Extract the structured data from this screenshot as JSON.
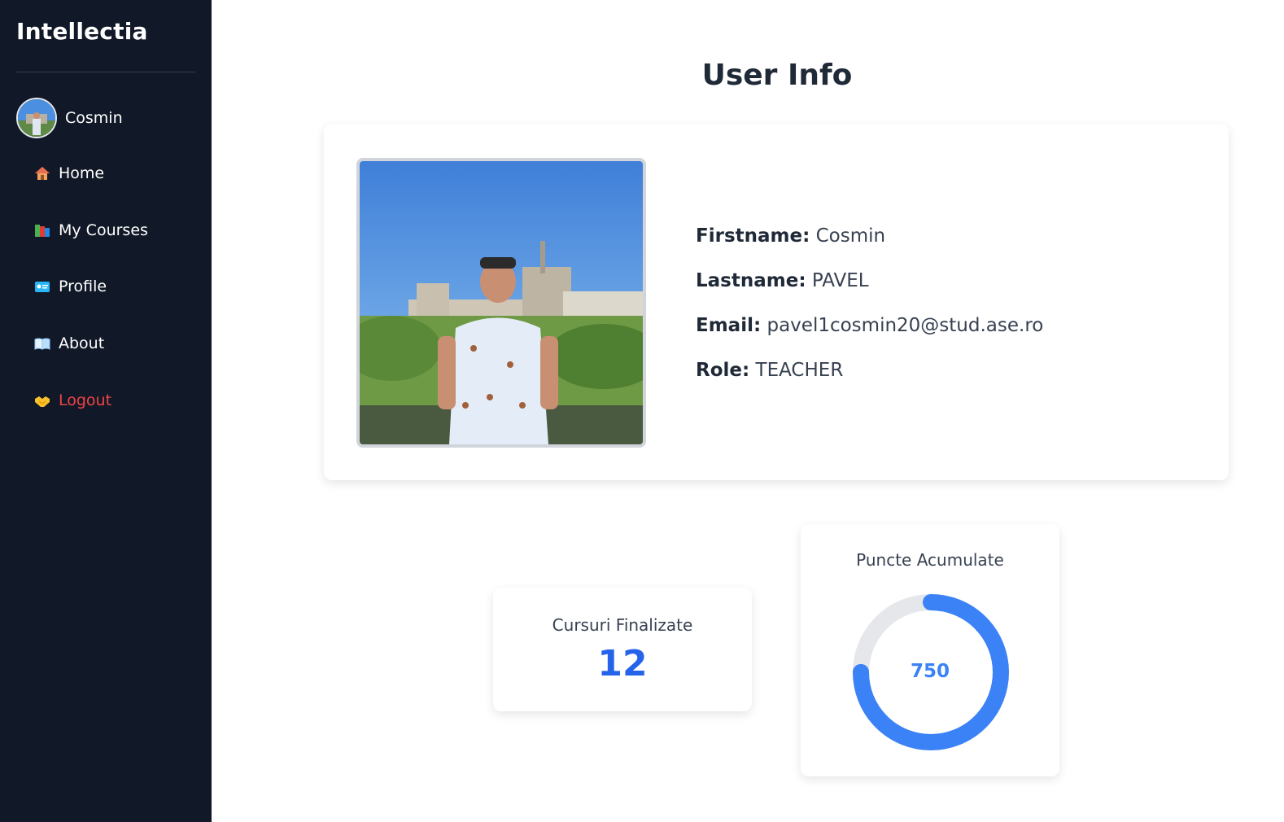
{
  "app": {
    "brand": "Intellectia"
  },
  "sidebar": {
    "user_name": "Cosmin",
    "items": [
      {
        "label": "Home",
        "icon": "house-icon"
      },
      {
        "label": "My Courses",
        "icon": "books-icon"
      },
      {
        "label": "Profile",
        "icon": "id-card-icon"
      },
      {
        "label": "About",
        "icon": "open-book-icon"
      },
      {
        "label": "Logout",
        "icon": "handshake-icon",
        "color": "#ef4444"
      }
    ]
  },
  "main": {
    "title": "User Info",
    "user": {
      "firstname_label": "Firstname:",
      "firstname": "Cosmin",
      "lastname_label": "Lastname:",
      "lastname": "PAVEL",
      "email_label": "Email:",
      "email": "pavel1cosmin20@stud.ase.ro",
      "role_label": "Role:",
      "role": "TEACHER"
    },
    "stats": {
      "courses_label": "Cursuri Finalizate",
      "courses_value": "12",
      "points_label": "Puncte Acumulate",
      "points_value": "750",
      "points_progress": 0.75
    }
  },
  "colors": {
    "sidebar_bg": "#111827",
    "accent": "#2563eb",
    "ring": "#3b82f6",
    "ring_track": "#e5e7eb",
    "logout": "#ef4444"
  }
}
